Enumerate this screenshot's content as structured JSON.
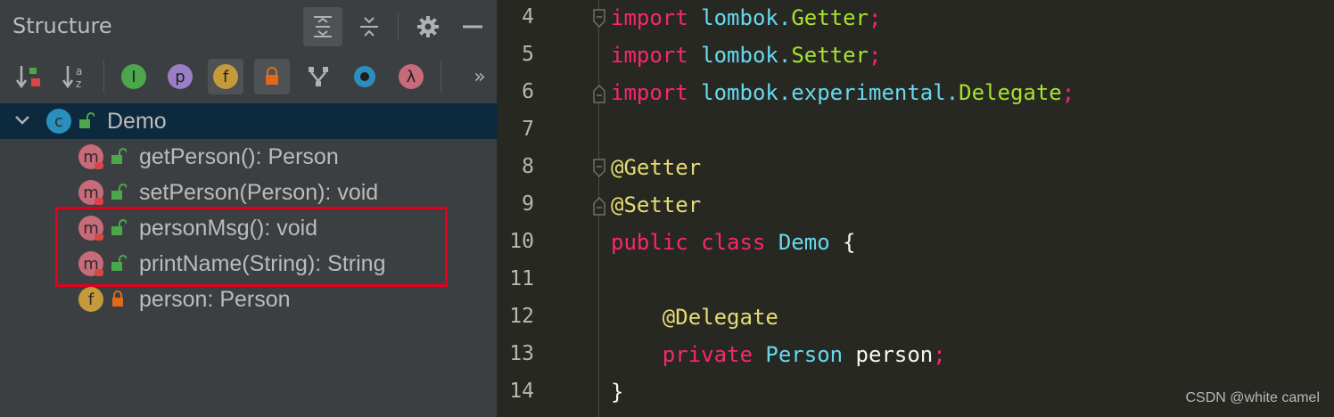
{
  "structure": {
    "title": "Structure",
    "tree": {
      "root": {
        "label": "Demo",
        "kind_letter": "c"
      },
      "children": [
        {
          "label": "getPerson(): Person",
          "kind_letter": "m",
          "access": "public",
          "highlighted": false
        },
        {
          "label": "setPerson(Person): void",
          "kind_letter": "m",
          "access": "public",
          "highlighted": false
        },
        {
          "label": "personMsg(): void",
          "kind_letter": "m",
          "access": "public",
          "highlighted": true
        },
        {
          "label": "printName(String): String",
          "kind_letter": "m",
          "access": "public",
          "highlighted": true
        },
        {
          "label": "person: Person",
          "kind_letter": "f",
          "access": "private",
          "highlighted": false
        }
      ]
    },
    "toolbar": {
      "inherited_letter": "I",
      "properties_letter": "p",
      "fields_letter": "f",
      "lambda_letter": "λ",
      "more": "»"
    }
  },
  "editor": {
    "line_numbers": [
      "4",
      "5",
      "6",
      "7",
      "8",
      "9",
      "10",
      "11",
      "12",
      "13",
      "14"
    ],
    "lines": [
      [
        [
          "kw",
          "import"
        ],
        [
          "txt",
          " "
        ],
        [
          "pkg",
          "lombok."
        ],
        [
          "cls",
          "Getter"
        ],
        [
          "semi",
          ";"
        ]
      ],
      [
        [
          "kw",
          "import"
        ],
        [
          "txt",
          " "
        ],
        [
          "pkg",
          "lombok."
        ],
        [
          "cls",
          "Setter"
        ],
        [
          "semi",
          ";"
        ]
      ],
      [
        [
          "kw",
          "import"
        ],
        [
          "txt",
          " "
        ],
        [
          "pkg",
          "lombok.experimental."
        ],
        [
          "cls",
          "Delegate"
        ],
        [
          "semi",
          ";"
        ]
      ],
      [],
      [
        [
          "ann",
          "@Getter"
        ]
      ],
      [
        [
          "ann",
          "@Setter"
        ]
      ],
      [
        [
          "kw",
          "public"
        ],
        [
          "txt",
          " "
        ],
        [
          "kw",
          "class"
        ],
        [
          "txt",
          " "
        ],
        [
          "ty",
          "Demo"
        ],
        [
          "txt",
          " {"
        ]
      ],
      [],
      [
        [
          "txt",
          "    "
        ],
        [
          "ann",
          "@Delegate"
        ]
      ],
      [
        [
          "txt",
          "    "
        ],
        [
          "kw",
          "private"
        ],
        [
          "txt",
          " "
        ],
        [
          "ty",
          "Person"
        ],
        [
          "txt",
          " person"
        ],
        [
          "semi",
          ";"
        ]
      ],
      [
        [
          "txt",
          "}"
        ]
      ]
    ]
  },
  "watermark": "CSDN @white camel",
  "colors": {
    "method_icon": "#c76a7a",
    "field_icon": "#c49a3a",
    "class_icon": "#2a8fbd",
    "public_lock": "#4ca64c",
    "private_lock": "#e06a1b",
    "highlight": "#e3001b"
  }
}
